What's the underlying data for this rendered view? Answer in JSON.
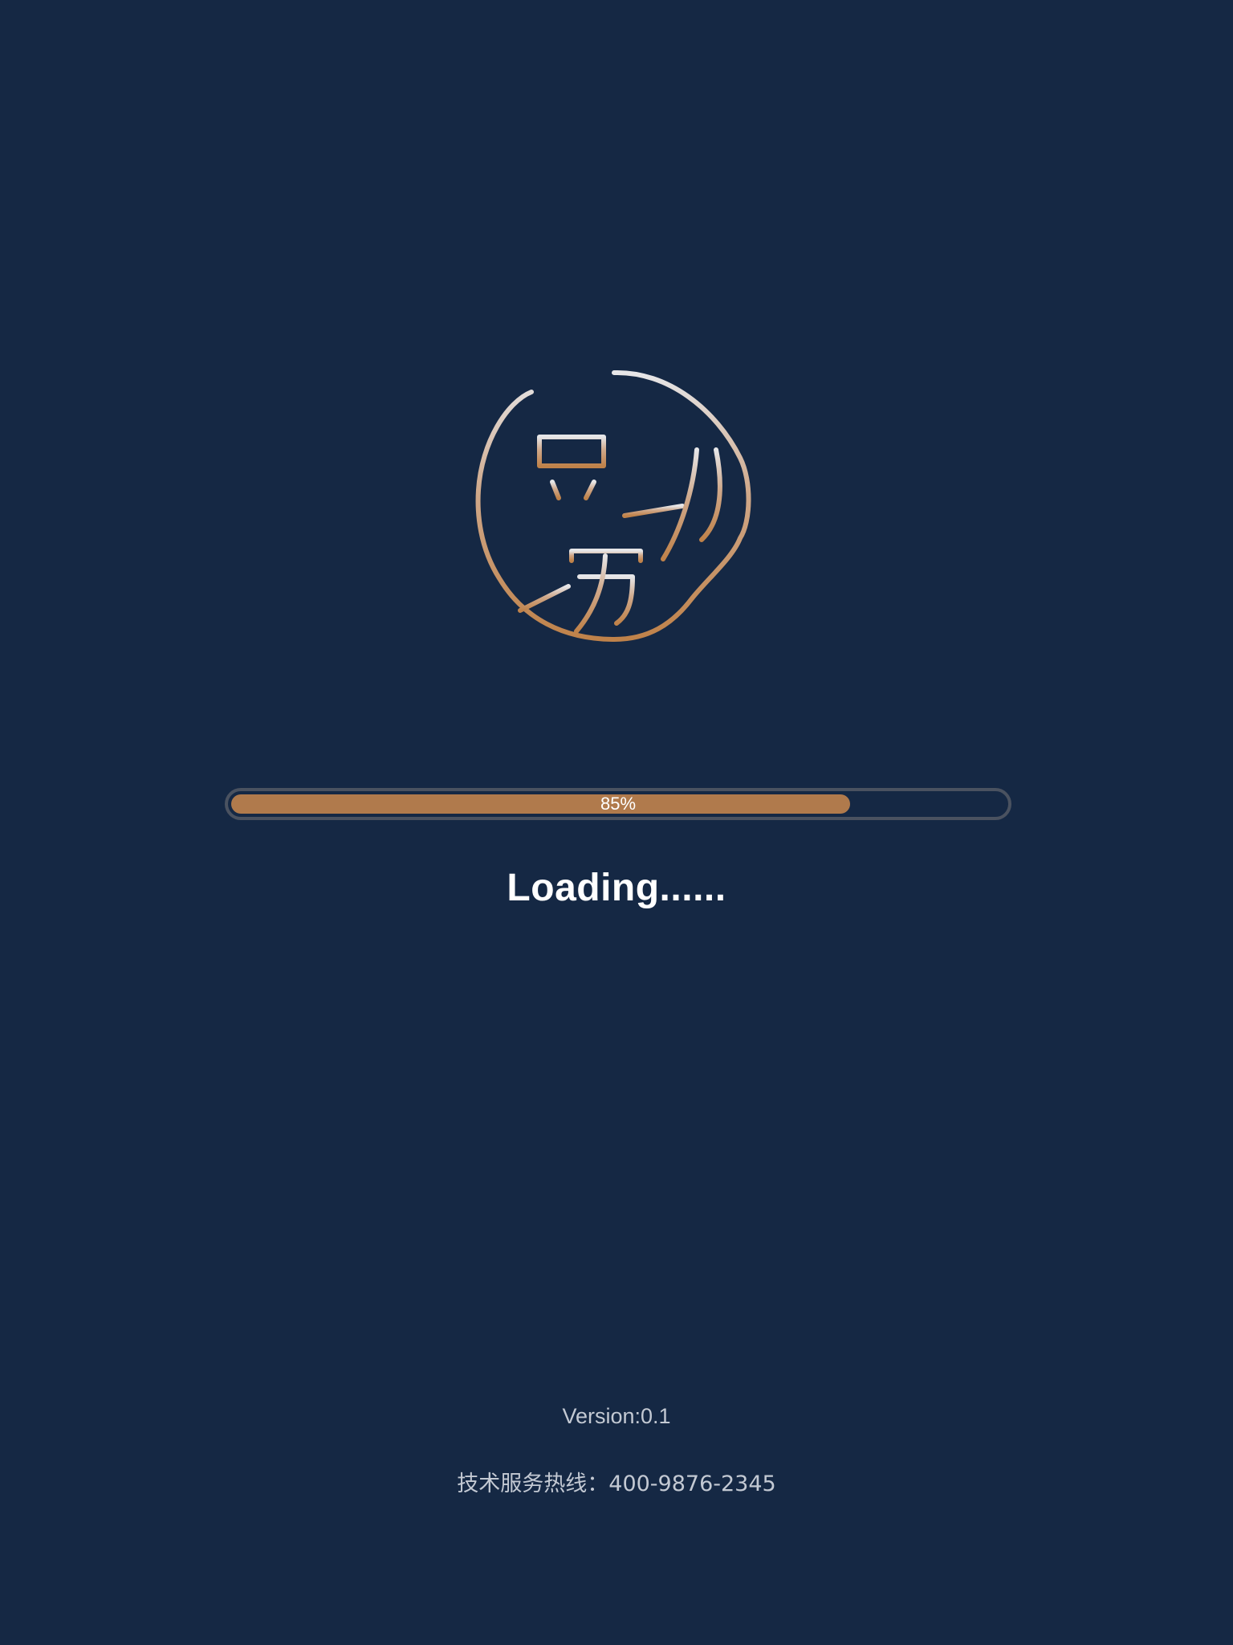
{
  "app": {
    "logo_text": "豆捞坊",
    "logo_icon": "circular-seal-logo-icon"
  },
  "progress": {
    "value": 0.8,
    "label": "85%"
  },
  "status": {
    "loading_text": "Loading......"
  },
  "footer": {
    "version": "Version:0.1",
    "hotline_label": "技术服务热线：",
    "hotline_number": "400-9876-2345"
  },
  "colors": {
    "background": "#152844",
    "accent": "#b07a4c",
    "track_border": "#4a5260",
    "text_primary": "#ffffff",
    "text_secondary": "#c3c9d3"
  }
}
